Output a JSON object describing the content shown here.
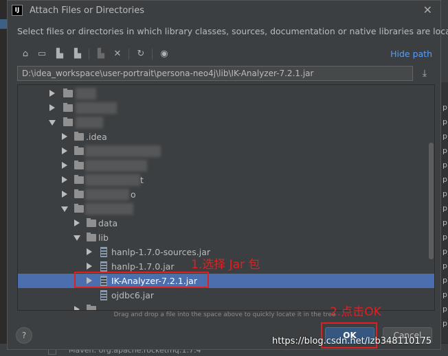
{
  "dialog": {
    "title": "Attach Files or Directories",
    "app_icon": "IJ",
    "description": "Select files or directories in which library classes, sources, documentation or native libraries are located"
  },
  "toolbar": {
    "icons": [
      "home-icon",
      "desktop-icon",
      "project-folder-icon",
      "module-folder-icon",
      "new-folder-icon",
      "delete-icon",
      "refresh-icon",
      "show-hidden-icon"
    ],
    "hide_path_label": "Hide path"
  },
  "path": {
    "value": "D:\\idea_workspace\\user-portrait\\persona-neo4j\\lib\\IK-Analyzer-7.2.1.jar"
  },
  "tree": {
    "items": [
      {
        "label": "",
        "type": "folder",
        "expanded": false
      },
      {
        "label": "",
        "type": "folder",
        "expanded": false
      },
      {
        "label": "",
        "type": "folder",
        "expanded": true
      },
      {
        "label": ".idea",
        "type": "folder",
        "expanded": false
      },
      {
        "label": "",
        "type": "folder",
        "expanded": false
      },
      {
        "label": "",
        "type": "folder",
        "expanded": false
      },
      {
        "label": "t",
        "type": "folder",
        "expanded": false
      },
      {
        "label": "o",
        "type": "folder",
        "expanded": false
      },
      {
        "label": "",
        "type": "folder",
        "expanded": true
      },
      {
        "label": "data",
        "type": "folder",
        "expanded": false
      },
      {
        "label": "lib",
        "type": "folder",
        "expanded": true
      },
      {
        "label": "hanlp-1.7.0-sources.jar",
        "type": "jar",
        "expanded": false
      },
      {
        "label": "hanlp-1.7.0.jar",
        "type": "jar",
        "expanded": false
      },
      {
        "label": "IK-Analyzer-7.2.1.jar",
        "type": "jar",
        "expanded": false,
        "selected": true
      },
      {
        "label": "ojdbc6.jar",
        "type": "jar",
        "expanded": false
      }
    ]
  },
  "hint": "Drag and drop a file into the space above to quickly locate it in the tree",
  "buttons": {
    "help": "?",
    "ok": "OK",
    "cancel": "Cancel"
  },
  "annotations": {
    "step1": "1.选择 Jar 包",
    "step2": "2.点击OK",
    "color": "#e02020"
  },
  "watermark": "https://blog.csdn.net/lzb348110175",
  "background": {
    "bottom_text": "Maven: org.apache.rocketmq:1.7.4",
    "right_edge_glyph": "p"
  }
}
